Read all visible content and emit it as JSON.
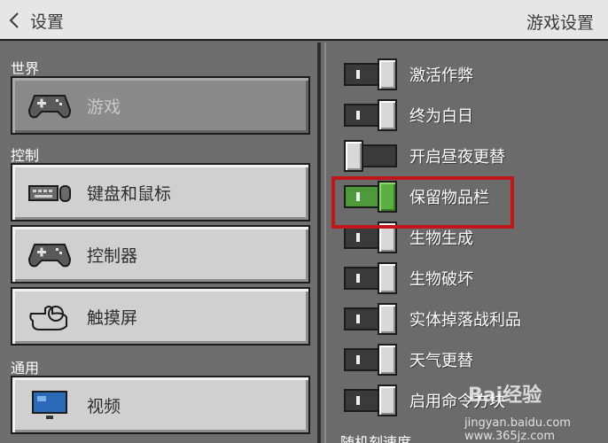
{
  "header": {
    "back_icon": "chevron-left-icon",
    "title": "设置",
    "right_title": "游戏设置"
  },
  "sidebar": {
    "sections": [
      {
        "label": "世界",
        "items": [
          {
            "label": "游戏",
            "icon": "gamepad-icon",
            "selected": true
          }
        ]
      },
      {
        "label": "控制",
        "items": [
          {
            "label": "键盘和鼠标",
            "icon": "keyboard-mouse-icon",
            "selected": false
          },
          {
            "label": "控制器",
            "icon": "gamepad-icon",
            "selected": false
          },
          {
            "label": "触摸屏",
            "icon": "touch-hand-icon",
            "selected": false
          }
        ]
      },
      {
        "label": "通用",
        "items": [
          {
            "label": "视频",
            "icon": "monitor-icon",
            "selected": false
          }
        ]
      }
    ]
  },
  "settings": {
    "toggles": [
      {
        "label": "激活作弊",
        "on": true
      },
      {
        "label": "终为白日",
        "on": true
      },
      {
        "label": "开启昼夜更替",
        "on": false
      },
      {
        "label": "保留物品栏",
        "on": true,
        "highlighted": true
      },
      {
        "label": "生物生成",
        "on": true
      },
      {
        "label": "生物破坏",
        "on": true
      },
      {
        "label": "实体掉落战利品",
        "on": true
      },
      {
        "label": "天气更替",
        "on": true
      },
      {
        "label": "启用命令方块",
        "on": true
      }
    ],
    "slider_label": "随机刻速度"
  },
  "colors": {
    "highlight": "#c01818",
    "toggle_on_accent": "#5cb043"
  },
  "watermark": {
    "brand": "Bai经验",
    "url": "jingyan.baidu.com www.365jz.com"
  }
}
